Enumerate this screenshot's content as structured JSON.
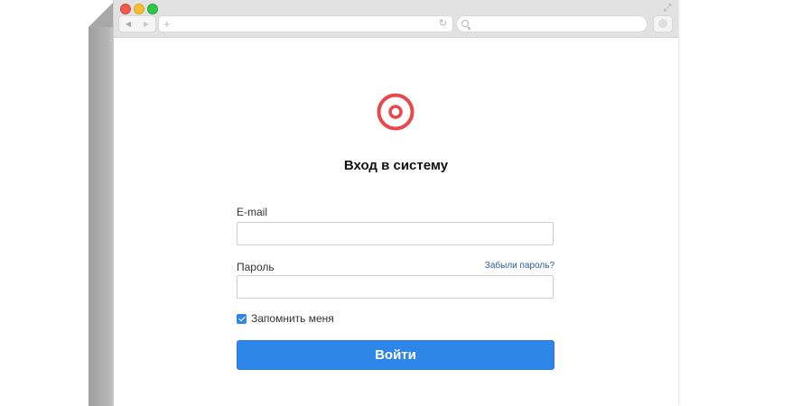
{
  "browser": {
    "nav_back_icon": "back-arrow-icon",
    "nav_forward_icon": "forward-arrow-icon",
    "new_tab_icon": "plus-icon",
    "reload_icon": "reload-icon",
    "search_icon": "search-icon",
    "expand_icon": "expand-icon",
    "address_value": "",
    "search_value": ""
  },
  "login": {
    "logo_icon": "target-logo-icon",
    "title": "Вход в систему",
    "email_label": "E-mail",
    "email_value": "",
    "password_label": "Пароль",
    "password_value": "",
    "forgot_link": "Забыли пароль?",
    "remember_label": "Запомнить меня",
    "remember_checked": true,
    "submit_label": "Войти"
  },
  "colors": {
    "accent": "#2e86e8",
    "logo": "#e8474c",
    "link": "#2a5d9f"
  }
}
